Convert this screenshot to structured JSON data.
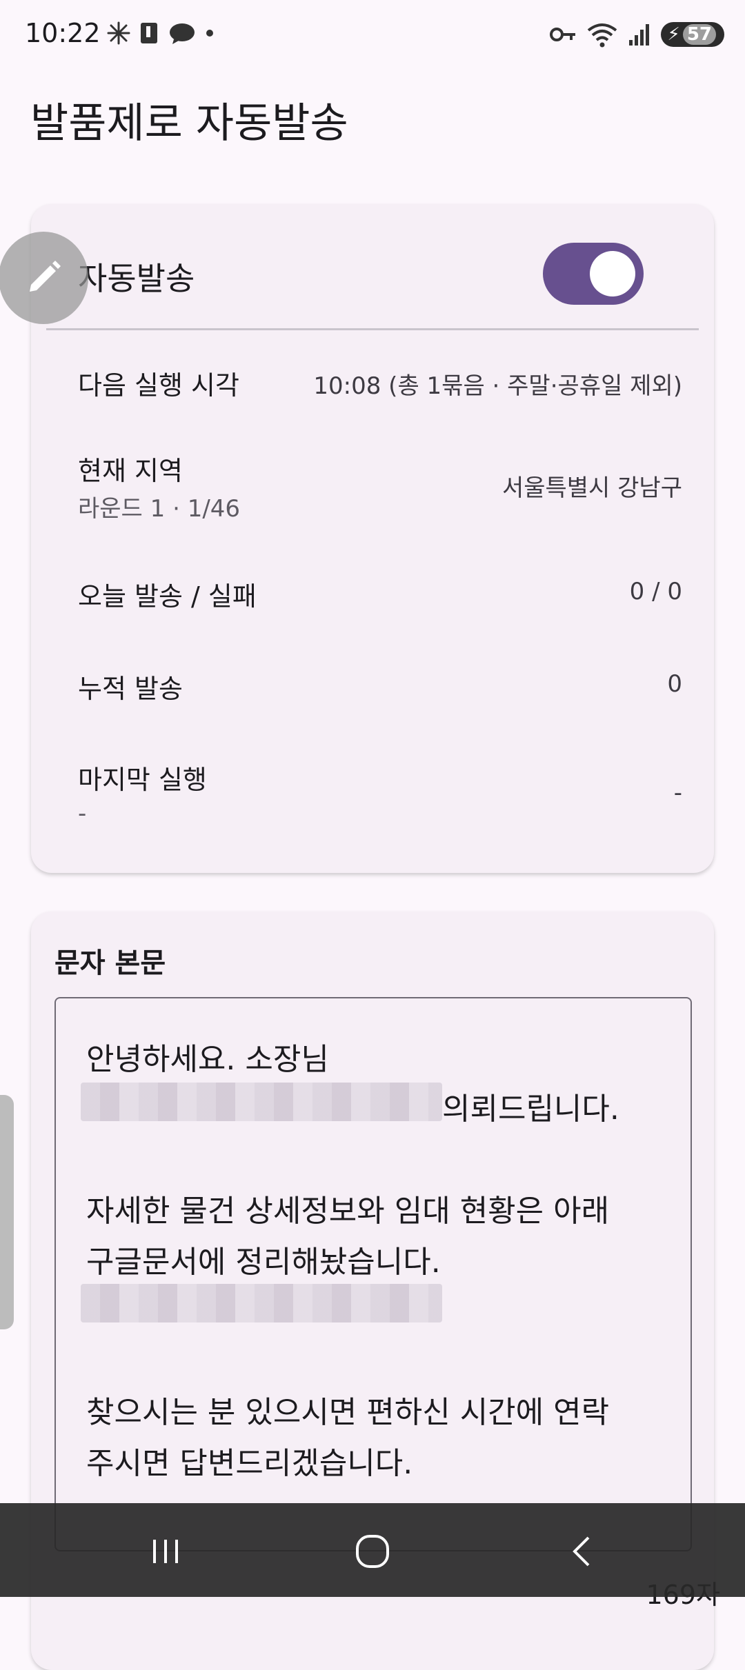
{
  "status_bar": {
    "time": "10:22",
    "battery": "57",
    "left_icons": [
      "pinwheel-icon",
      "phone-icon",
      "cloud-icon",
      "dot-icon"
    ],
    "right_icons": [
      "key-icon",
      "wifi-icon",
      "signal-icon",
      "battery-icon"
    ]
  },
  "page_title": "발품제로 자동발송",
  "auto_send": {
    "label": "자동발송",
    "enabled": true,
    "rows": {
      "next_run": {
        "label": "다음 실행 시각",
        "value": "10:08 (총 1묶음 · 주말·공휴일 제외)"
      },
      "region": {
        "label": "현재 지역",
        "sub": "라운드 1 · 1/46",
        "value": "서울특별시 강남구"
      },
      "today": {
        "label": "오늘 발송 / 실패",
        "value": "0 / 0"
      },
      "total": {
        "label": "누적 발송",
        "value": "0"
      },
      "last_run": {
        "label": "마지막 실행",
        "sub": "-",
        "value": "-"
      }
    }
  },
  "message": {
    "title": "문자 본문",
    "lines": [
      "안녕하세요. 소장님",
      "의뢰드립니다.",
      "자세한 물건 상세정보와 임대 현황은 아래",
      "구글문서에 정리해놨습니다.",
      "찾으시는 분 있으시면 편하신 시간에 연락",
      "주시면 답변드리겠습니다."
    ],
    "char_count": "169자"
  },
  "nav": {
    "recent": "recents-icon",
    "home": "home-icon",
    "back": "back-icon"
  },
  "colors": {
    "accent": "#67508f",
    "background": "#fcf7fc",
    "card": "#f6eff6"
  }
}
